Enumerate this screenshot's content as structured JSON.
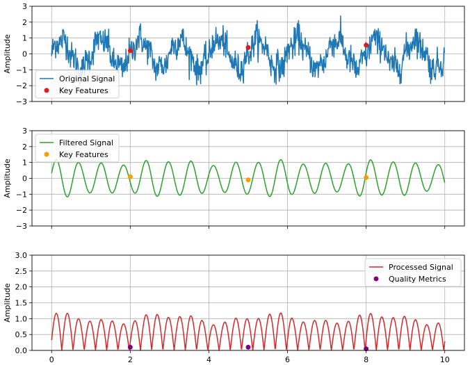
{
  "colors": {
    "original": "#1f77b4",
    "original_markers": "#e31a1c",
    "filtered": "#2ca02c",
    "filtered_markers": "#f5a000",
    "processed": "#d62728",
    "processed_markers": "#800080",
    "grid": "#b0b0b0"
  },
  "chart_data": [
    {
      "type": "line",
      "ylabel": "Amplitude",
      "xlim": [
        -0.5,
        10.5
      ],
      "ylim": [
        -3,
        3
      ],
      "xticks": [
        0,
        2,
        4,
        6,
        8,
        10
      ],
      "yticks": [
        -3,
        -2,
        -1,
        0,
        1,
        2,
        3
      ],
      "ytick_labels": [
        "−3",
        "−2",
        "−1",
        "0",
        "1",
        "2",
        "3"
      ],
      "show_xtick_labels": false,
      "grid": true,
      "legend_placement": "lower-left",
      "series": [
        {
          "name": "Original Signal",
          "kind": "line",
          "generator": "noisy_sine",
          "x_range": [
            0,
            10
          ],
          "amplitude": 1.0,
          "noise": 0.45
        }
      ],
      "markers": {
        "name": "Key Features",
        "x": [
          2,
          5,
          8
        ],
        "y": [
          0.2,
          0.4,
          0.55
        ]
      }
    },
    {
      "type": "line",
      "ylabel": "Amplitude",
      "xlim": [
        -0.5,
        10.5
      ],
      "ylim": [
        -3,
        3
      ],
      "xticks": [
        0,
        2,
        4,
        6,
        8,
        10
      ],
      "yticks": [
        -3,
        -2,
        -1,
        0,
        1,
        2,
        3
      ],
      "ytick_labels": [
        "−3",
        "−2",
        "−1",
        "0",
        "1",
        "2",
        "3"
      ],
      "show_xtick_labels": false,
      "grid": true,
      "legend_placement": "upper-left",
      "series": [
        {
          "name": "Filtered Signal",
          "kind": "line",
          "generator": "sine",
          "x_range": [
            0,
            10
          ],
          "amplitude": 1.0,
          "cycles": 17.5
        }
      ],
      "markers": {
        "name": "Key Features",
        "x": [
          2,
          5,
          8
        ],
        "y": [
          0.1,
          -0.1,
          0.05
        ]
      }
    },
    {
      "type": "line",
      "ylabel": "Amplitude",
      "xlim": [
        -0.5,
        10.5
      ],
      "ylim": [
        0,
        3
      ],
      "xticks": [
        0,
        2,
        4,
        6,
        8,
        10
      ],
      "xtick_labels": [
        "0",
        "2",
        "4",
        "6",
        "8",
        "10"
      ],
      "yticks": [
        0,
        0.5,
        1.0,
        1.5,
        2.0,
        2.5,
        3.0
      ],
      "ytick_labels": [
        "0.0",
        "0.5",
        "1.0",
        "1.5",
        "2.0",
        "2.5",
        "3.0"
      ],
      "show_xtick_labels": true,
      "grid": true,
      "legend_placement": "upper-right",
      "series": [
        {
          "name": "Processed Signal",
          "kind": "line",
          "generator": "abs_sine",
          "x_range": [
            0,
            10
          ],
          "amplitude": 1.0,
          "cycles": 17.5
        }
      ],
      "markers": {
        "name": "Quality Metrics",
        "x": [
          2,
          5,
          8
        ],
        "y": [
          0.1,
          0.1,
          0.05
        ]
      }
    }
  ]
}
